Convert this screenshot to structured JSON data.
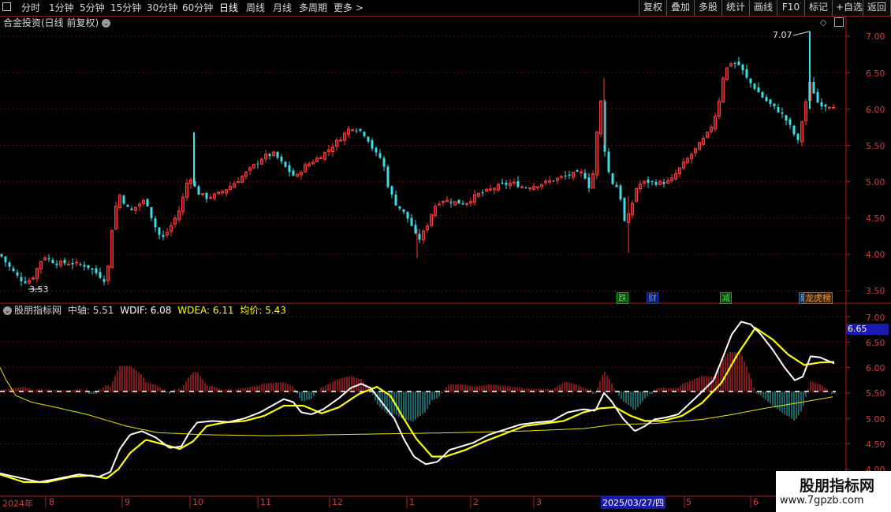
{
  "toolbar": {
    "periods": [
      "分时",
      "1分钟",
      "5分钟",
      "15分钟",
      "30分钟",
      "60分钟",
      "日线",
      "周线",
      "月线",
      "多周期",
      "更多 >"
    ],
    "active_period": "日线",
    "buttons": [
      "复权",
      "叠加",
      "多股",
      "统计",
      "画线",
      "F10",
      "标记",
      "+自选",
      "返回"
    ]
  },
  "main_panel": {
    "title": "合金投资(日线 前复权)",
    "high_label": "7.07",
    "low_label": "3.53",
    "events": [
      {
        "text": "跌",
        "color": "#18b018"
      },
      {
        "text": "财",
        "color": "#1a3ad8"
      },
      {
        "text": "减",
        "color": "#18b018"
      },
      {
        "text": "融",
        "color": "#1a7ad8"
      },
      {
        "text": "龙虎榜",
        "color": "#c06010"
      }
    ]
  },
  "indicator": {
    "name": "股朋指标网",
    "zhongzhou_label": "中轴: 5.51",
    "wdif_label": "WDIF: 6.08",
    "wdea_label": "WDEA: 6.11",
    "avg_label": "均价: 5.43",
    "current_value": "6.65",
    "colors": {
      "wdif": "#ffffff",
      "wdea": "#ffff00",
      "avg": "#ffff00",
      "up": "#ff3030",
      "down": "#30c8c8"
    }
  },
  "price_axis": [
    "7.00",
    "6.50",
    "6.00",
    "5.50",
    "5.00",
    "4.50",
    "4.00",
    "3.50"
  ],
  "ind_axis": [
    "7.00",
    "6.50",
    "6.00",
    "5.50",
    "5.00",
    "4.50",
    "4.00"
  ],
  "date_axis": [
    "2024年",
    "8",
    "9",
    "10",
    "11",
    "12",
    "1",
    "2",
    "3",
    "2025/03/27/四",
    "5",
    "6"
  ],
  "watermark": {
    "title": "股朋指标网",
    "url": "www.7gpzb.com"
  },
  "chart_data": {
    "type": "candlestick",
    "title": "合金投资(日线 前复权)",
    "ylim": [
      3.5,
      7.07
    ],
    "x_months": [
      "2024年",
      "8",
      "9",
      "10",
      "11",
      "12",
      "1",
      "2",
      "3",
      "2025/03/27/四",
      "5",
      "6"
    ],
    "close_points": [
      [
        0,
        4.0
      ],
      [
        10,
        3.85
      ],
      [
        20,
        3.72
      ],
      [
        30,
        3.62
      ],
      [
        40,
        3.65
      ],
      [
        55,
        3.98
      ],
      [
        70,
        3.88
      ],
      [
        90,
        3.88
      ],
      [
        110,
        3.84
      ],
      [
        125,
        3.72
      ],
      [
        135,
        3.62
      ],
      [
        142,
        4.35
      ],
      [
        150,
        4.85
      ],
      [
        165,
        4.58
      ],
      [
        175,
        4.68
      ],
      [
        185,
        4.75
      ],
      [
        195,
        4.42
      ],
      [
        205,
        4.2
      ],
      [
        215,
        4.35
      ],
      [
        228,
        4.62
      ],
      [
        240,
        5.1
      ],
      [
        250,
        4.85
      ],
      [
        262,
        4.78
      ],
      [
        275,
        4.82
      ],
      [
        290,
        4.92
      ],
      [
        305,
        5.05
      ],
      [
        320,
        5.2
      ],
      [
        335,
        5.35
      ],
      [
        348,
        5.38
      ],
      [
        360,
        5.22
      ],
      [
        375,
        5.05
      ],
      [
        385,
        5.2
      ],
      [
        400,
        5.3
      ],
      [
        415,
        5.42
      ],
      [
        430,
        5.58
      ],
      [
        445,
        5.75
      ],
      [
        455,
        5.72
      ],
      [
        465,
        5.62
      ],
      [
        475,
        5.4
      ],
      [
        485,
        5.3
      ],
      [
        492,
        4.95
      ],
      [
        500,
        4.72
      ],
      [
        510,
        4.6
      ],
      [
        520,
        4.45
      ],
      [
        530,
        4.18
      ],
      [
        540,
        4.35
      ],
      [
        550,
        4.65
      ],
      [
        560,
        4.75
      ],
      [
        575,
        4.72
      ],
      [
        590,
        4.7
      ],
      [
        605,
        4.82
      ],
      [
        620,
        4.88
      ],
      [
        635,
        4.95
      ],
      [
        650,
        4.98
      ],
      [
        665,
        4.92
      ],
      [
        680,
        4.95
      ],
      [
        695,
        5.0
      ],
      [
        710,
        5.05
      ],
      [
        725,
        5.1
      ],
      [
        740,
        5.12
      ],
      [
        750,
        4.85
      ],
      [
        755,
        5.5
      ],
      [
        762,
        6.1
      ],
      [
        768,
        5.3
      ],
      [
        775,
        5.0
      ],
      [
        785,
        4.9
      ],
      [
        792,
        4.45
      ],
      [
        798,
        4.55
      ],
      [
        808,
        4.95
      ],
      [
        820,
        5.0
      ],
      [
        835,
        4.98
      ],
      [
        850,
        5.0
      ],
      [
        862,
        5.18
      ],
      [
        875,
        5.35
      ],
      [
        890,
        5.55
      ],
      [
        900,
        5.7
      ],
      [
        910,
        6.0
      ],
      [
        918,
        6.5
      ],
      [
        928,
        6.65
      ],
      [
        938,
        6.6
      ],
      [
        948,
        6.4
      ],
      [
        958,
        6.28
      ],
      [
        968,
        6.15
      ],
      [
        978,
        6.05
      ],
      [
        990,
        5.95
      ],
      [
        1000,
        5.8
      ],
      [
        1012,
        5.55
      ],
      [
        1020,
        6.0
      ],
      [
        1028,
        6.4
      ],
      [
        1035,
        6.1
      ],
      [
        1045,
        6.05
      ],
      [
        1058,
        6.05
      ]
    ],
    "ind_points": {
      "wdif": [
        [
          0,
          3.92
        ],
        [
          20,
          3.85
        ],
        [
          50,
          3.75
        ],
        [
          75,
          3.82
        ],
        [
          100,
          3.9
        ],
        [
          125,
          3.85
        ],
        [
          140,
          3.95
        ],
        [
          152,
          4.4
        ],
        [
          165,
          4.68
        ],
        [
          180,
          4.75
        ],
        [
          198,
          4.62
        ],
        [
          215,
          4.42
        ],
        [
          230,
          4.45
        ],
        [
          240,
          4.72
        ],
        [
          250,
          4.92
        ],
        [
          270,
          4.95
        ],
        [
          290,
          4.93
        ],
        [
          310,
          5.0
        ],
        [
          330,
          5.12
        ],
        [
          345,
          5.25
        ],
        [
          360,
          5.38
        ],
        [
          372,
          5.32
        ],
        [
          382,
          5.12
        ],
        [
          395,
          5.08
        ],
        [
          410,
          5.18
        ],
        [
          430,
          5.4
        ],
        [
          445,
          5.6
        ],
        [
          458,
          5.68
        ],
        [
          470,
          5.6
        ],
        [
          485,
          5.3
        ],
        [
          500,
          5.0
        ],
        [
          512,
          4.6
        ],
        [
          525,
          4.25
        ],
        [
          540,
          4.1
        ],
        [
          555,
          4.15
        ],
        [
          570,
          4.38
        ],
        [
          585,
          4.45
        ],
        [
          600,
          4.52
        ],
        [
          620,
          4.68
        ],
        [
          640,
          4.78
        ],
        [
          660,
          4.88
        ],
        [
          680,
          4.92
        ],
        [
          700,
          4.95
        ],
        [
          720,
          5.12
        ],
        [
          740,
          5.18
        ],
        [
          755,
          5.15
        ],
        [
          766,
          5.5
        ],
        [
          775,
          5.35
        ],
        [
          790,
          5.0
        ],
        [
          805,
          4.75
        ],
        [
          818,
          4.85
        ],
        [
          830,
          4.98
        ],
        [
          845,
          5.02
        ],
        [
          860,
          5.08
        ],
        [
          875,
          5.3
        ],
        [
          890,
          5.52
        ],
        [
          905,
          5.75
        ],
        [
          918,
          6.25
        ],
        [
          928,
          6.65
        ],
        [
          940,
          6.9
        ],
        [
          952,
          6.85
        ],
        [
          965,
          6.65
        ],
        [
          980,
          6.35
        ],
        [
          995,
          6.0
        ],
        [
          1008,
          5.75
        ],
        [
          1018,
          5.82
        ],
        [
          1028,
          6.22
        ],
        [
          1040,
          6.2
        ],
        [
          1058,
          6.08
        ]
      ],
      "wdea": [
        [
          0,
          3.9
        ],
        [
          30,
          3.75
        ],
        [
          60,
          3.75
        ],
        [
          90,
          3.85
        ],
        [
          115,
          3.88
        ],
        [
          135,
          3.82
        ],
        [
          150,
          4.0
        ],
        [
          165,
          4.32
        ],
        [
          185,
          4.58
        ],
        [
          205,
          4.5
        ],
        [
          228,
          4.4
        ],
        [
          245,
          4.55
        ],
        [
          262,
          4.85
        ],
        [
          285,
          4.92
        ],
        [
          310,
          4.95
        ],
        [
          335,
          5.05
        ],
        [
          360,
          5.25
        ],
        [
          385,
          5.25
        ],
        [
          408,
          5.1
        ],
        [
          430,
          5.22
        ],
        [
          455,
          5.48
        ],
        [
          478,
          5.62
        ],
        [
          495,
          5.45
        ],
        [
          510,
          5.05
        ],
        [
          528,
          4.6
        ],
        [
          548,
          4.25
        ],
        [
          565,
          4.25
        ],
        [
          590,
          4.38
        ],
        [
          615,
          4.55
        ],
        [
          640,
          4.7
        ],
        [
          665,
          4.85
        ],
        [
          690,
          4.9
        ],
        [
          715,
          4.95
        ],
        [
          740,
          5.12
        ],
        [
          762,
          5.2
        ],
        [
          780,
          5.22
        ],
        [
          800,
          5.05
        ],
        [
          818,
          4.95
        ],
        [
          840,
          4.95
        ],
        [
          865,
          5.05
        ],
        [
          890,
          5.3
        ],
        [
          915,
          5.7
        ],
        [
          935,
          6.25
        ],
        [
          958,
          6.78
        ],
        [
          980,
          6.55
        ],
        [
          1000,
          6.25
        ],
        [
          1020,
          6.05
        ],
        [
          1040,
          6.1
        ],
        [
          1058,
          6.11
        ]
      ],
      "avg": [
        [
          0,
          6.0
        ],
        [
          8,
          5.75
        ],
        [
          20,
          5.45
        ],
        [
          40,
          5.32
        ],
        [
          70,
          5.22
        ],
        [
          110,
          5.08
        ],
        [
          160,
          4.85
        ],
        [
          200,
          4.72
        ],
        [
          260,
          4.68
        ],
        [
          340,
          4.66
        ],
        [
          420,
          4.68
        ],
        [
          500,
          4.7
        ],
        [
          580,
          4.72
        ],
        [
          660,
          4.75
        ],
        [
          740,
          4.8
        ],
        [
          780,
          4.88
        ],
        [
          830,
          4.9
        ],
        [
          890,
          4.98
        ],
        [
          930,
          5.08
        ],
        [
          970,
          5.2
        ],
        [
          1010,
          5.3
        ],
        [
          1058,
          5.43
        ]
      ]
    }
  }
}
